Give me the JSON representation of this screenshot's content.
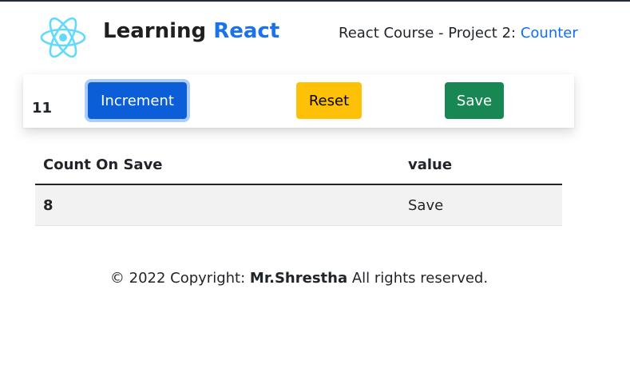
{
  "header": {
    "brand_prefix": "Learning",
    "brand_accent": "React",
    "subtitle_prefix": "React Course - Project 2:",
    "subtitle_link": "Counter",
    "logo_icon": "react-atom-icon",
    "accent_color": "#1a73e8"
  },
  "counter": {
    "value": "11",
    "increment_label": "Increment",
    "reset_label": "Reset",
    "save_label": "Save"
  },
  "table": {
    "headers": [
      "Count On Save",
      "value"
    ],
    "rows": [
      {
        "count": "8",
        "value": "Save"
      }
    ]
  },
  "footer": {
    "prefix": "© 2022 Copyright:",
    "author": "Mr.Shrestha",
    "suffix": "All rights reserved."
  }
}
